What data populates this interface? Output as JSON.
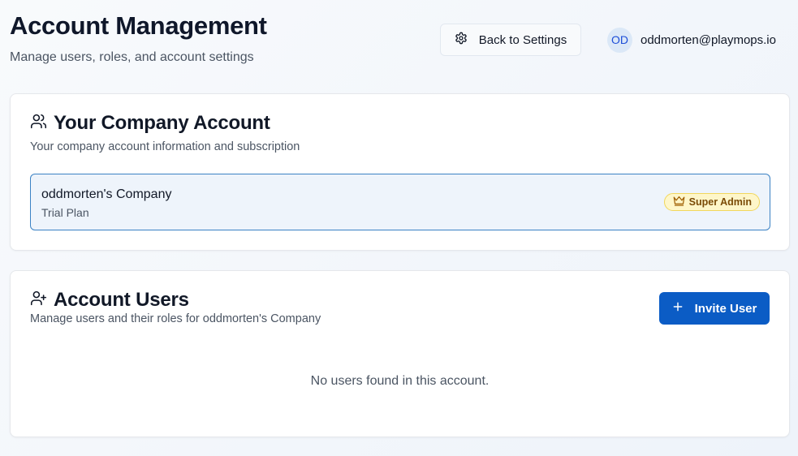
{
  "header": {
    "title": "Account Management",
    "subtitle": "Manage users, roles, and account settings",
    "back_button": {
      "label": "Back to Settings",
      "icon": "gear-icon"
    },
    "user": {
      "initials": "OD",
      "email": "oddmorten@playmops.io"
    }
  },
  "company_card": {
    "icon": "users-icon",
    "title": "Your Company Account",
    "description": "Your company account information and subscription",
    "company": {
      "name": "oddmorten's Company",
      "plan": "Trial Plan",
      "role_badge": {
        "label": "Super Admin",
        "icon": "crown-icon"
      }
    }
  },
  "users_card": {
    "icon": "user-plus-icon",
    "title": "Account Users",
    "description": "Manage users and their roles for oddmorten's Company",
    "invite_button": {
      "label": "Invite User",
      "icon": "plus-icon"
    },
    "empty_message": "No users found in this account."
  },
  "colors": {
    "primary": "#0b5cc5",
    "badge_bg": "#fef6c9",
    "badge_text": "#7a4a05",
    "selected_border": "#3b82c4"
  }
}
